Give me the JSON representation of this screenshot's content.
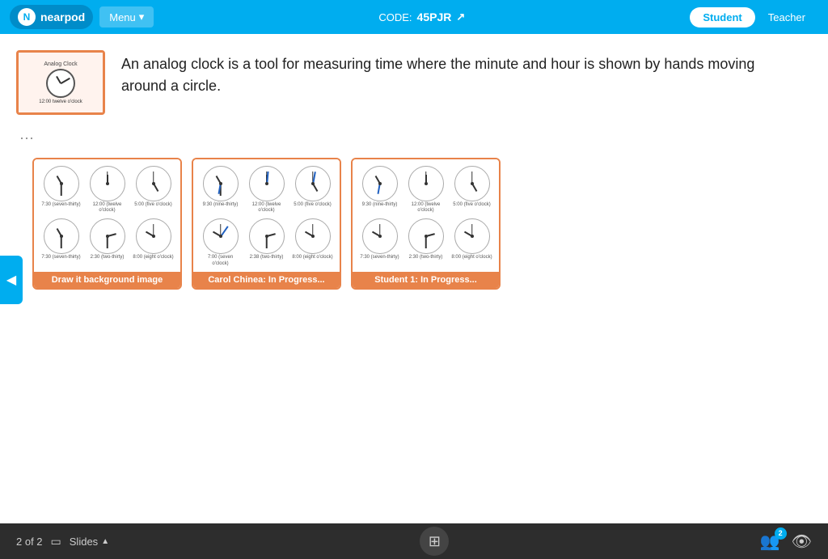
{
  "header": {
    "logo_text": "nearpod",
    "menu_label": "Menu",
    "code_label": "CODE:",
    "code_value": "45PJR",
    "student_tab": "Student",
    "teacher_tab": "Teacher"
  },
  "slide": {
    "description": "An analog clock is a tool for measuring time where the minute and hour is shown by hands moving around a circle.",
    "thumb_label": "Analog Clock",
    "thumb_time": "12:00 twelve o'clock"
  },
  "cards": [
    {
      "id": "draw-background",
      "footer": "Draw it background image",
      "type": "background"
    },
    {
      "id": "carol-chinea",
      "footer": "Carol Chinea: In Progress...",
      "type": "student"
    },
    {
      "id": "student1",
      "footer": "Student 1: In Progress...",
      "type": "student"
    }
  ],
  "card_labels": {
    "row1": [
      "7:30 (seven-thirty)",
      "12:00 (twelve o'clock)",
      "5:00 (five o'clock)"
    ],
    "row2": [
      "7:30 (seven-thirty)",
      "2:30 (two-thirty)",
      "8:00 (eight o'clock)"
    ]
  },
  "footer": {
    "page_info": "2 of 2",
    "slides_label": "Slides",
    "badge_count": "2"
  }
}
